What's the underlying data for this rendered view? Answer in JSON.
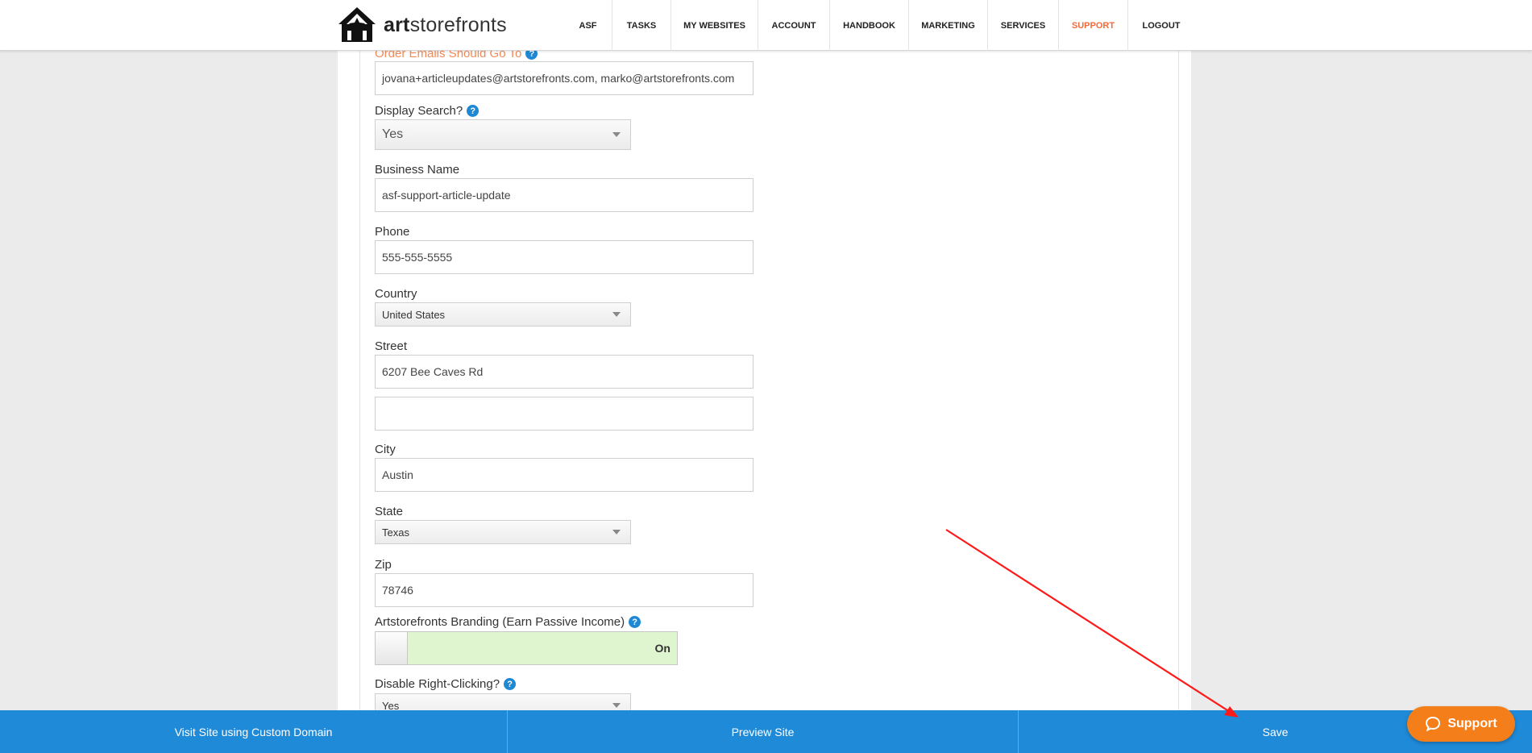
{
  "brand": {
    "bold": "art",
    "rest": "storefronts"
  },
  "nav": {
    "items": [
      {
        "label": "ASF",
        "width": 60
      },
      {
        "label": "TASKS",
        "width": 73
      },
      {
        "label": "MY WEBSITES",
        "width": 108
      },
      {
        "label": "ACCOUNT",
        "width": 89
      },
      {
        "label": "HANDBOOK",
        "width": 98
      },
      {
        "label": "MARKETING",
        "width": 98
      },
      {
        "label": "SERVICES",
        "width": 88
      },
      {
        "label": "SUPPORT",
        "width": 86,
        "active": true
      },
      {
        "label": "LOGOUT",
        "width": 82
      }
    ]
  },
  "form": {
    "order_emails_label": "Order Emails Should Go To",
    "order_emails_value": "jovana+articleupdates@artstorefronts.com, marko@artstorefronts.com",
    "display_search_label": "Display Search?",
    "display_search_value": "Yes",
    "business_name_label": "Business Name",
    "business_name_value": "asf-support-article-update",
    "phone_label": "Phone",
    "phone_value": "555-555-5555",
    "country_label": "Country",
    "country_value": "United States",
    "street_label": "Street",
    "street_value": "6207 Bee Caves Rd",
    "street2_value": "",
    "city_label": "City",
    "city_value": "Austin",
    "state_label": "State",
    "state_value": "Texas",
    "zip_label": "Zip",
    "zip_value": "78746",
    "branding_label": "Artstorefronts Branding (Earn Passive Income)",
    "branding_toggle": "On",
    "disable_right_click_label": "Disable Right-Clicking?",
    "disable_right_click_value": "Yes"
  },
  "bottom_bar": {
    "visit_site": "Visit Site using Custom Domain",
    "preview_site": "Preview Site",
    "save": "Save"
  },
  "support_widget": "Support",
  "colors": {
    "accent": "#1f8ad8",
    "orange": "#f26b3a",
    "support": "#f47f1a",
    "annotation": "#ff1a1a"
  }
}
